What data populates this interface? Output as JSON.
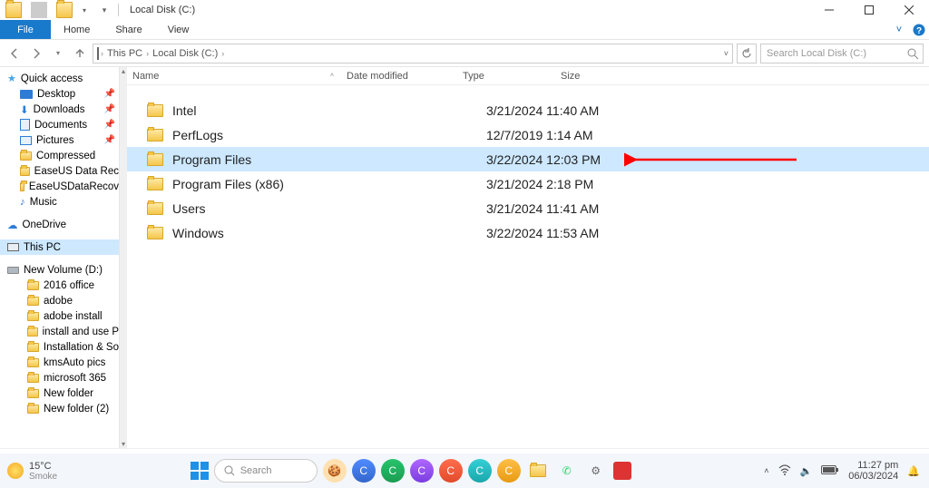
{
  "window": {
    "title": "Local Disk (C:)",
    "ribbon": {
      "file": "File",
      "tabs": [
        "Home",
        "Share",
        "View"
      ]
    },
    "nav": {
      "crumbs": [
        "This PC",
        "Local Disk (C:)"
      ],
      "search_placeholder": "Search Local Disk (C:)"
    }
  },
  "columns": {
    "name": "Name",
    "date": "Date modified",
    "type": "Type",
    "size": "Size"
  },
  "items": [
    {
      "name": "Intel",
      "date": "3/21/2024 11:40 AM",
      "selected": false
    },
    {
      "name": "PerfLogs",
      "date": "12/7/2019 1:14 AM",
      "selected": false
    },
    {
      "name": "Program Files",
      "date": "3/22/2024 12:03 PM",
      "selected": true
    },
    {
      "name": "Program Files (x86)",
      "date": "3/21/2024 2:18 PM",
      "selected": false
    },
    {
      "name": "Users",
      "date": "3/21/2024 11:41 AM",
      "selected": false
    },
    {
      "name": "Windows",
      "date": "3/22/2024 11:53 AM",
      "selected": false
    }
  ],
  "tree": {
    "quick": {
      "label": "Quick access",
      "items": [
        "Desktop",
        "Downloads",
        "Documents",
        "Pictures",
        "Compressed",
        "EaseUS Data Rec",
        "EaseUSDataRecov",
        "Music"
      ]
    },
    "onedrive": "OneDrive",
    "thispc": "This PC",
    "drive": {
      "label": "New Volume (D:)",
      "items": [
        "2016 office",
        "adobe",
        "adobe install",
        "install and use P",
        "Installation & So",
        "kmsAuto pics",
        "microsoft 365",
        "New folder",
        "New folder (2)"
      ]
    }
  },
  "taskbar": {
    "weather_temp": "15°C",
    "weather_text": "Smoke",
    "search": "Search",
    "time": "11:27 pm",
    "date": "06/03/2024"
  },
  "annotation_arrow_color": "#ff0000"
}
